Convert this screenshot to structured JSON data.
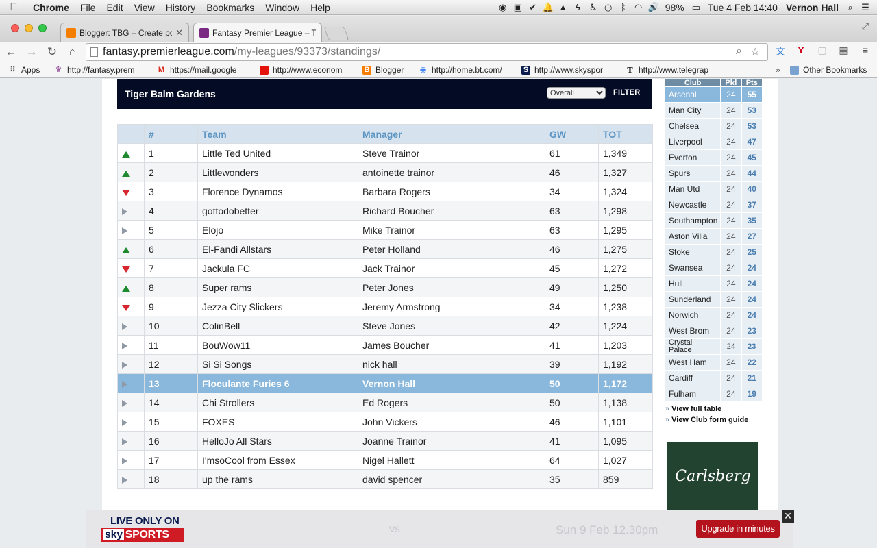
{
  "menubar": {
    "app": "Chrome",
    "menus": [
      "File",
      "Edit",
      "View",
      "History",
      "Bookmarks",
      "Window",
      "Help"
    ],
    "battery": "98%",
    "datetime": "Tue 4 Feb  14:40",
    "user": "Vernon Hall"
  },
  "browser": {
    "tabs": [
      {
        "title": "Blogger: TBG – Create post",
        "favicon_color": "#f57d00"
      },
      {
        "title": "Fantasy Premier League – T",
        "favicon_color": "#7b2a84"
      }
    ],
    "url_host": "fantasy.premierleague.com",
    "url_path": "/my-leagues/93373/standings/",
    "bookmarks": [
      {
        "label": "Apps",
        "icon": "apps-grid-icon",
        "color": "#666666"
      },
      {
        "label": "http://fantasy.prem",
        "icon": "fpl-lion-icon",
        "color": "#7b2a84"
      },
      {
        "label": "https://mail.google",
        "icon": "gmail-icon",
        "color": "#d93025"
      },
      {
        "label": "http://www.econom",
        "icon": "economist-icon",
        "color": "#e3120b"
      },
      {
        "label": "Blogger",
        "icon": "blogger-icon",
        "color": "#f57d00"
      },
      {
        "label": "http://home.bt.com/",
        "icon": "chrome-icon",
        "color": "#4285f4"
      },
      {
        "label": "http://www.skyspor",
        "icon": "sky-sports-icon",
        "color": "#0b1d4f"
      },
      {
        "label": "http://www.telegrap",
        "icon": "telegraph-icon",
        "color": "#111111"
      }
    ],
    "other_bookmarks": "Other Bookmarks"
  },
  "league": {
    "name": "Tiger Balm Gardens",
    "filter_selected": "Overall",
    "filter_label": "FILTER",
    "columns": [
      "#",
      "Team",
      "Manager",
      "GW",
      "TOT"
    ],
    "rows": [
      {
        "move": "up",
        "rank": "1",
        "team": "Little Ted United",
        "manager": "Steve Trainor",
        "gw": "61",
        "tot": "1,349"
      },
      {
        "move": "up",
        "rank": "2",
        "team": "Littlewonders",
        "manager": "antoinette trainor",
        "gw": "46",
        "tot": "1,327"
      },
      {
        "move": "down",
        "rank": "3",
        "team": "Florence Dynamos",
        "manager": "Barbara Rogers",
        "gw": "34",
        "tot": "1,324"
      },
      {
        "move": "same",
        "rank": "4",
        "team": "gottodobetter",
        "manager": "Richard Boucher",
        "gw": "63",
        "tot": "1,298"
      },
      {
        "move": "same",
        "rank": "5",
        "team": "Elojo",
        "manager": "Mike Trainor",
        "gw": "63",
        "tot": "1,295"
      },
      {
        "move": "up",
        "rank": "6",
        "team": "El-Fandi Allstars",
        "manager": "Peter Holland",
        "gw": "46",
        "tot": "1,275"
      },
      {
        "move": "down",
        "rank": "7",
        "team": "Jackula FC",
        "manager": "Jack Trainor",
        "gw": "45",
        "tot": "1,272"
      },
      {
        "move": "up",
        "rank": "8",
        "team": "Super rams",
        "manager": "Peter Jones",
        "gw": "49",
        "tot": "1,250"
      },
      {
        "move": "down",
        "rank": "9",
        "team": "Jezza City Slickers",
        "manager": "Jeremy Armstrong",
        "gw": "34",
        "tot": "1,238"
      },
      {
        "move": "same",
        "rank": "10",
        "team": "ColinBell",
        "manager": "Steve Jones",
        "gw": "42",
        "tot": "1,224"
      },
      {
        "move": "same",
        "rank": "11",
        "team": "BouWow11",
        "manager": "James Boucher",
        "gw": "41",
        "tot": "1,203"
      },
      {
        "move": "same",
        "rank": "12",
        "team": "Si Si Songs",
        "manager": "nick hall",
        "gw": "39",
        "tot": "1,192"
      },
      {
        "move": "same",
        "rank": "13",
        "team": "Floculante Furies 6",
        "manager": "Vernon Hall",
        "gw": "50",
        "tot": "1,172",
        "highlight": true
      },
      {
        "move": "same",
        "rank": "14",
        "team": "Chi Strollers",
        "manager": "Ed Rogers",
        "gw": "50",
        "tot": "1,138"
      },
      {
        "move": "same",
        "rank": "15",
        "team": "FOXES",
        "manager": "John Vickers",
        "gw": "46",
        "tot": "1,101"
      },
      {
        "move": "same",
        "rank": "16",
        "team": "HelloJo All Stars",
        "manager": "Joanne Trainor",
        "gw": "41",
        "tot": "1,095"
      },
      {
        "move": "same",
        "rank": "17",
        "team": "I'msoCool from Essex",
        "manager": "Nigel Hallett",
        "gw": "64",
        "tot": "1,027"
      },
      {
        "move": "same",
        "rank": "18",
        "team": "up the rams",
        "manager": "david spencer",
        "gw": "35",
        "tot": "859"
      }
    ]
  },
  "pl_table": {
    "columns": [
      "Club",
      "Pld",
      "Pts"
    ],
    "rows": [
      {
        "club": "Arsenal",
        "pld": "24",
        "pts": "55",
        "highlight": true
      },
      {
        "club": "Man City",
        "pld": "24",
        "pts": "53"
      },
      {
        "club": "Chelsea",
        "pld": "24",
        "pts": "53"
      },
      {
        "club": "Liverpool",
        "pld": "24",
        "pts": "47"
      },
      {
        "club": "Everton",
        "pld": "24",
        "pts": "45"
      },
      {
        "club": "Spurs",
        "pld": "24",
        "pts": "44"
      },
      {
        "club": "Man Utd",
        "pld": "24",
        "pts": "40"
      },
      {
        "club": "Newcastle",
        "pld": "24",
        "pts": "37"
      },
      {
        "club": "Southampton",
        "pld": "24",
        "pts": "35"
      },
      {
        "club": "Aston Villa",
        "pld": "24",
        "pts": "27"
      },
      {
        "club": "Stoke",
        "pld": "24",
        "pts": "25"
      },
      {
        "club": "Swansea",
        "pld": "24",
        "pts": "24"
      },
      {
        "club": "Hull",
        "pld": "24",
        "pts": "24"
      },
      {
        "club": "Sunderland",
        "pld": "24",
        "pts": "24"
      },
      {
        "club": "Norwich",
        "pld": "24",
        "pts": "24"
      },
      {
        "club": "West Brom",
        "pld": "24",
        "pts": "23"
      },
      {
        "club": "Crystal Palace",
        "pld": "24",
        "pts": "23",
        "two_line": true
      },
      {
        "club": "West Ham",
        "pld": "24",
        "pts": "22"
      },
      {
        "club": "Cardiff",
        "pld": "24",
        "pts": "21"
      },
      {
        "club": "Fulham",
        "pld": "24",
        "pts": "19"
      }
    ],
    "links": [
      "View full table",
      "View Club form guide"
    ]
  },
  "ads": {
    "carlsberg": "Carlsberg",
    "sky_live": "LIVE ONLY ON",
    "sky_logo_a": "sky",
    "sky_logo_b": "SPORTS",
    "sky_vs": "vs",
    "sky_date": "Sun 9 Feb 12.30pm",
    "sky_cta": "Upgrade in minutes",
    "close": "✕"
  },
  "colors": {
    "league_header_bg": "#040b25",
    "table_header_bg": "#d6e3ef",
    "table_header_text": "#5d95c2",
    "highlight_row": "#89b8dc",
    "up": "#1e8a2d",
    "down": "#d8262e",
    "same": "#8e99a5"
  }
}
